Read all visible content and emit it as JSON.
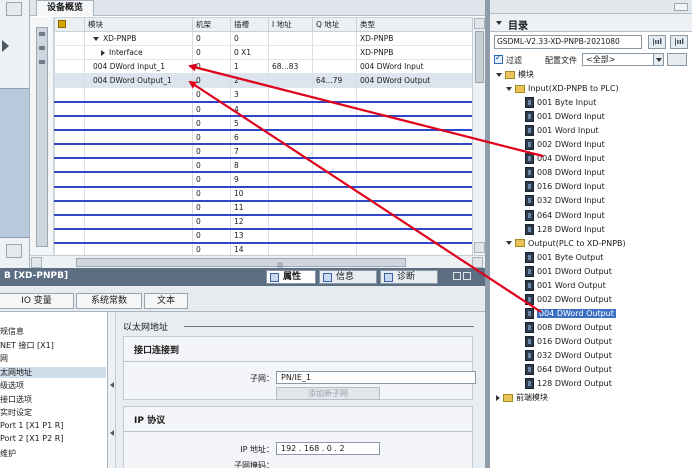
{
  "overview": {
    "tab_label": "设备概览",
    "columns": [
      "",
      "模块",
      "机架",
      "插槽",
      "I 地址",
      "Q 地址",
      "类型"
    ],
    "rows": [
      {
        "module": "XD-PNPB",
        "rack": "0",
        "slot": "0",
        "i_addr": "",
        "q_addr": "",
        "type": "XD-PNPB",
        "indent": 1,
        "caret": "down"
      },
      {
        "module": "Interface",
        "rack": "0",
        "slot": "0 X1",
        "i_addr": "",
        "q_addr": "",
        "type": "XD-PNPB",
        "indent": 2,
        "caret": "right"
      },
      {
        "module": "004 DWord Input_1",
        "rack": "0",
        "slot": "1",
        "i_addr": "68...83",
        "q_addr": "",
        "type": "004 DWord Input",
        "indent": 1,
        "caret": ""
      },
      {
        "module": "004 DWord Output_1",
        "rack": "0",
        "slot": "2",
        "i_addr": "",
        "q_addr": "64...79",
        "type": "004 DWord Output",
        "indent": 1,
        "caret": ""
      },
      {
        "module": "",
        "rack": "0",
        "slot": "3"
      },
      {
        "module": "",
        "rack": "0",
        "slot": "4"
      },
      {
        "module": "",
        "rack": "0",
        "slot": "5"
      },
      {
        "module": "",
        "rack": "0",
        "slot": "6"
      },
      {
        "module": "",
        "rack": "0",
        "slot": "7"
      },
      {
        "module": "",
        "rack": "0",
        "slot": "8"
      },
      {
        "module": "",
        "rack": "0",
        "slot": "9"
      },
      {
        "module": "",
        "rack": "0",
        "slot": "10"
      },
      {
        "module": "",
        "rack": "0",
        "slot": "11"
      },
      {
        "module": "",
        "rack": "0",
        "slot": "12"
      },
      {
        "module": "",
        "rack": "0",
        "slot": "13"
      },
      {
        "module": "",
        "rack": "0",
        "slot": "14"
      }
    ],
    "hscroll_grip": "|||"
  },
  "properties": {
    "title": "B [XD-PNPB]",
    "tabs": {
      "props": "属性",
      "info": "信息",
      "diag": "诊断"
    },
    "subtabs": [
      "IO 变量",
      "系统常数",
      "文本"
    ],
    "nav_items": [
      "规信息",
      "NET 接口 [X1]",
      "网",
      "太网地址",
      "级选项",
      "接口选项",
      "实时设定",
      "Port 1 [X1 P1 R]",
      "Port 2 [X1 P2 R]",
      "维护"
    ],
    "nav_selected": 3,
    "section_title": "以太网地址",
    "interface_box": {
      "header": "接口连接到",
      "subnet_label": "子网：",
      "subnet_value": "PN/IE_1",
      "add_subnet": "添加新子网"
    },
    "ip_box": {
      "header": "IP 协议",
      "ip_label": "IP 地址：",
      "ip_value": "192 . 168 . 0 . 2",
      "mask_label": "子网掩码："
    }
  },
  "catalog": {
    "title": "目录",
    "search_value": "GSDML-V2.33-XD-PNPB-2021080",
    "search_btn1": "|ııl",
    "search_btn2": "|ııl",
    "filter_label": "过滤",
    "profile_label": "配置文件",
    "profile_value": "<全部>",
    "tree": [
      {
        "label": "模块",
        "level": 0,
        "kind": "folder",
        "caret": "down"
      },
      {
        "label": "Input(XD-PNPB to PLC)",
        "level": 1,
        "kind": "folder",
        "caret": "down"
      },
      {
        "label": "001 Byte Input",
        "level": 2,
        "kind": "module"
      },
      {
        "label": "001 DWord Input",
        "level": 2,
        "kind": "module"
      },
      {
        "label": "001 Word Input",
        "level": 2,
        "kind": "module"
      },
      {
        "label": "002 DWord Input",
        "level": 2,
        "kind": "module"
      },
      {
        "label": "004 DWord Input",
        "level": 2,
        "kind": "module"
      },
      {
        "label": "008 DWord Input",
        "level": 2,
        "kind": "module"
      },
      {
        "label": "016 DWord Input",
        "level": 2,
        "kind": "module"
      },
      {
        "label": "032 DWord Input",
        "level": 2,
        "kind": "module"
      },
      {
        "label": "064 DWord Input",
        "level": 2,
        "kind": "module"
      },
      {
        "label": "128 DWord Input",
        "level": 2,
        "kind": "module"
      },
      {
        "label": "Output(PLC to XD-PNPB)",
        "level": 1,
        "kind": "folder",
        "caret": "down"
      },
      {
        "label": "001 Byte Output",
        "level": 2,
        "kind": "module"
      },
      {
        "label": "001 DWord Output",
        "level": 2,
        "kind": "module"
      },
      {
        "label": "001 Word Output",
        "level": 2,
        "kind": "module"
      },
      {
        "label": "002 DWord Output",
        "level": 2,
        "kind": "module"
      },
      {
        "label": "004 DWord Output",
        "level": 2,
        "kind": "module",
        "selected": true
      },
      {
        "label": "008 DWord Output",
        "level": 2,
        "kind": "module"
      },
      {
        "label": "016 DWord Output",
        "level": 2,
        "kind": "module"
      },
      {
        "label": "032 DWord Output",
        "level": 2,
        "kind": "module"
      },
      {
        "label": "064 DWord Output",
        "level": 2,
        "kind": "module"
      },
      {
        "label": "128 DWord Output",
        "level": 2,
        "kind": "module"
      },
      {
        "label": "前端模块",
        "level": 0,
        "kind": "folder",
        "caret": "right"
      }
    ]
  },
  "colors": {
    "arrow": "#e0001b",
    "selection": "#3a6fc4",
    "empty_row_line": "#2f46c7"
  }
}
